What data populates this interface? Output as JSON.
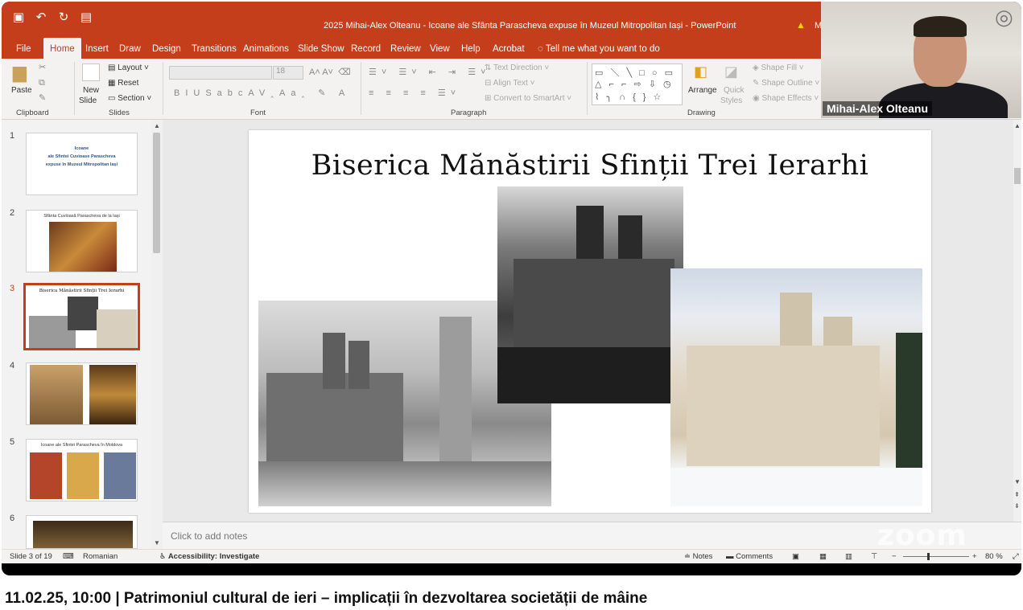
{
  "window": {
    "doc_title": "2025 Mihai-Alex Olteanu - Icoane ale  Sfânta Parascheva expuse în Muzeul Mitropolitan Iași  -  PowerPoint",
    "title_extra": "M",
    "warning_icon": "warning-icon"
  },
  "qat": {
    "icons": [
      "save-icon",
      "undo-icon",
      "redo-icon",
      "present-icon"
    ]
  },
  "ribbon_tabs": [
    "File",
    "Home",
    "Insert",
    "Draw",
    "Design",
    "Transitions",
    "Animations",
    "Slide Show",
    "Record",
    "Review",
    "View",
    "Help",
    "Acrobat"
  ],
  "active_tab": "Home",
  "tell_me": "Tell me what you want to do",
  "ribbon": {
    "clipboard": {
      "paste": "Paste",
      "label": "Clipboard"
    },
    "slides": {
      "new_slide_1": "New",
      "new_slide_2": "Slide",
      "layout": "Layout",
      "reset": "Reset",
      "section": "Section",
      "label": "Slides"
    },
    "font": {
      "size": "18",
      "label": "Font"
    },
    "paragraph": {
      "text_direction": "Text Direction",
      "align_text": "Align Text",
      "convert": "Convert to SmartArt",
      "label": "Paragraph"
    },
    "drawing": {
      "arrange": "Arrange",
      "quick_styles_1": "Quick",
      "quick_styles_2": "Styles",
      "shape_fill": "Shape Fill",
      "shape_outline": "Shape Outline",
      "shape_effects": "Shape Effects",
      "label": "Drawing"
    }
  },
  "webcam": {
    "participant": "Mihai-Alex Olteanu"
  },
  "thumbnails": [
    {
      "num": "1",
      "lines": [
        "Icoane",
        "ale Sfintei Cuvioase Parascheva",
        "expuse în Muzeul Mitropolitan Iași"
      ]
    },
    {
      "num": "2",
      "title": "Sfânta Cuvioasă Parascheva de la Iași"
    },
    {
      "num": "3",
      "title": "Biserica Mănăstirii Sfinții Trei Ierarhi"
    },
    {
      "num": "4"
    },
    {
      "num": "5",
      "title": "Icoane ale Sfintei Parascheva în Moldova"
    },
    {
      "num": "6"
    }
  ],
  "slide": {
    "title": "Biserica Mănăstirii Sfinții Trei Ierarhi"
  },
  "notes": {
    "placeholder": "Click to add notes",
    "watermark": "zoom"
  },
  "status": {
    "slide_of": "Slide 3 of 19",
    "language": "Romanian",
    "accessibility": "Accessibility: Investigate",
    "notes": "Notes",
    "comments": "Comments",
    "zoom": "80 %"
  },
  "caption": "11.02.25, 10:00 | Patrimoniul cultural de ieri – implicații în dezvoltarea societății de mâine"
}
